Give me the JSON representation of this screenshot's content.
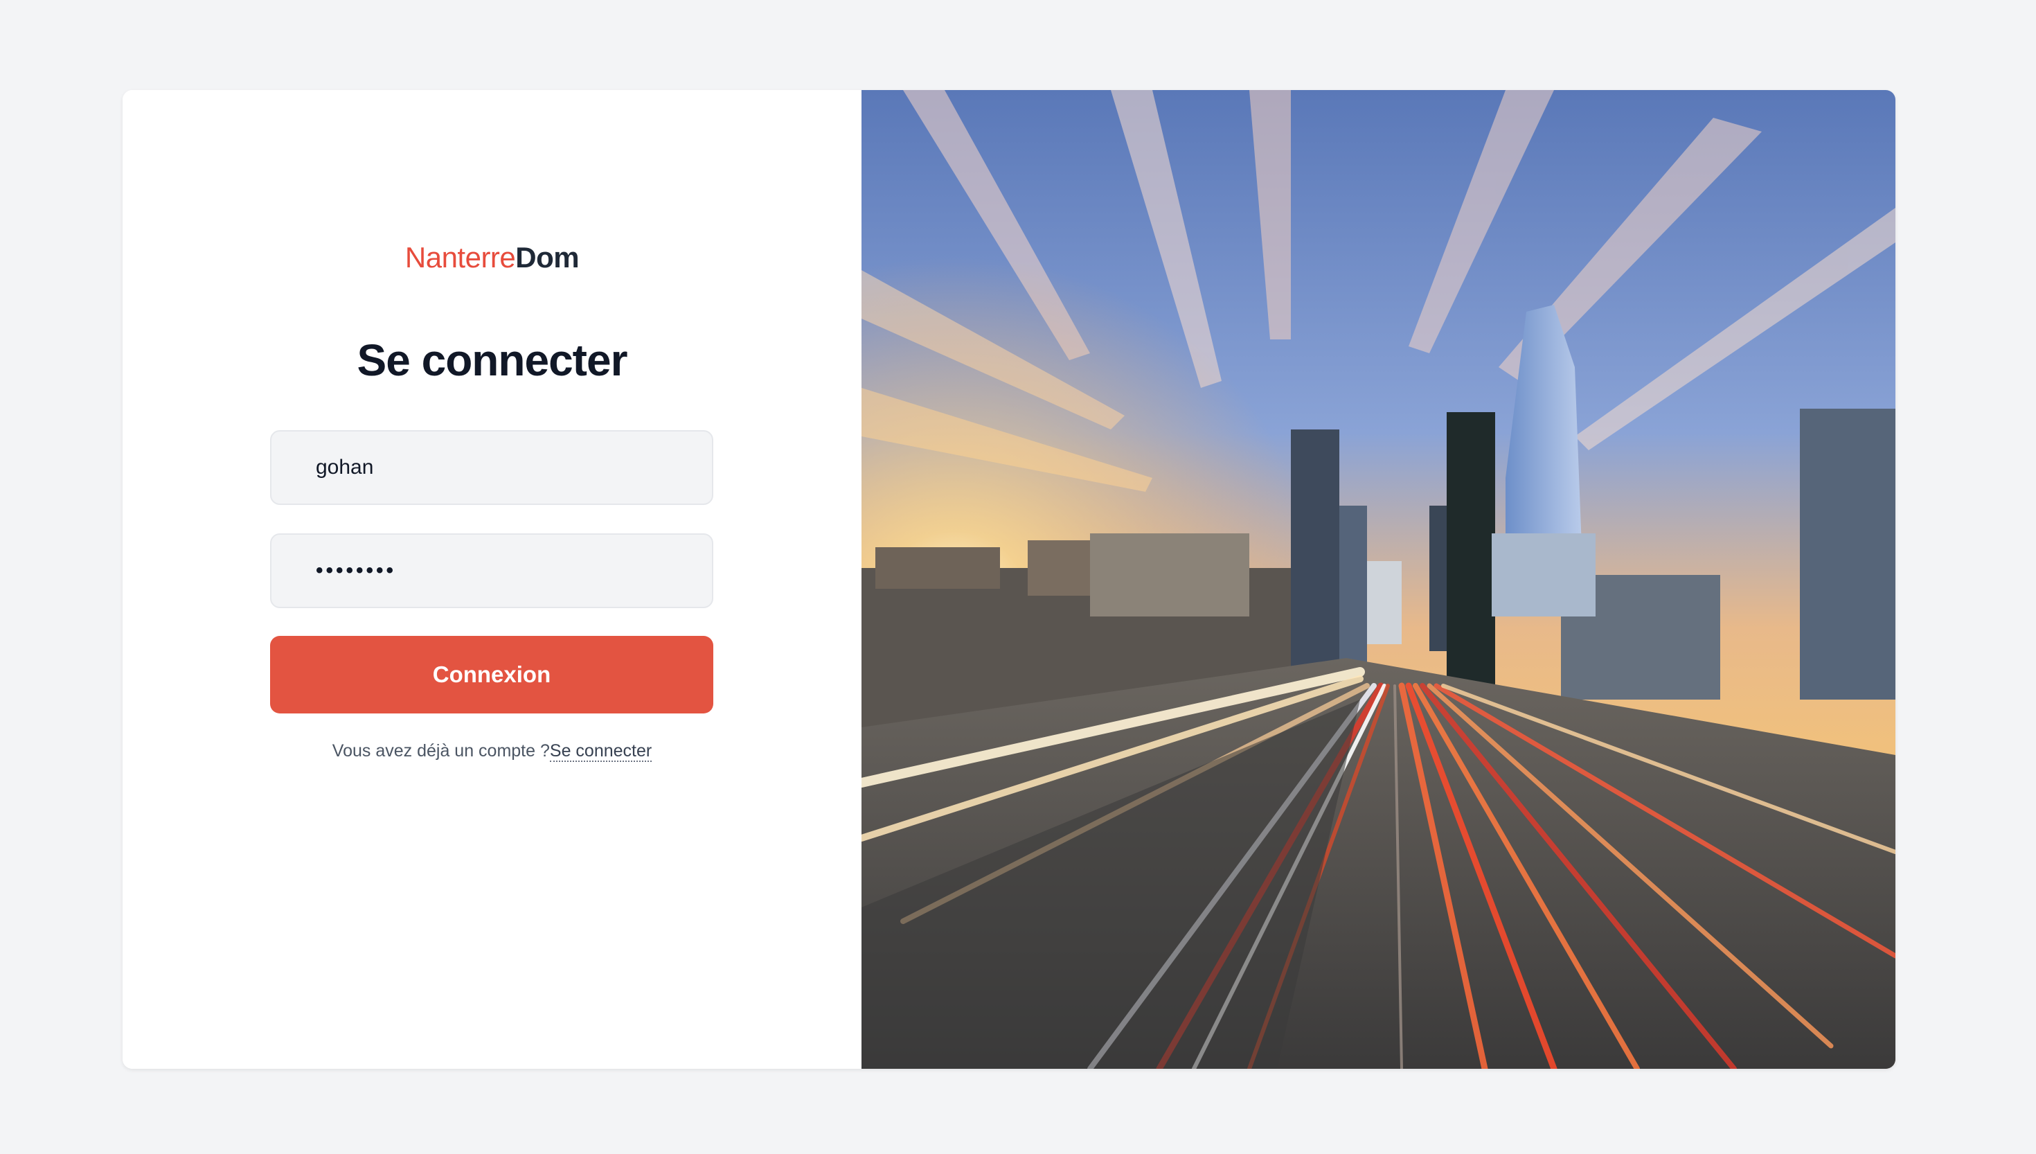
{
  "logo": {
    "part_a": "Nanterre",
    "part_b": "Dom"
  },
  "form": {
    "title": "Se connecter",
    "username_value": "gohan",
    "password_mask": "••••••••",
    "submit_label": "Connexion",
    "footer_text": "Vous avez déjà un compte ?",
    "footer_link": "Se connecter"
  },
  "colors": {
    "accent": "#e35441",
    "brand_red": "#e74c3c",
    "page_background": "#f3f4f6",
    "input_background": "#f3f4f6"
  },
  "hero_image": {
    "subject": "city-skyline-light-trails-image"
  }
}
